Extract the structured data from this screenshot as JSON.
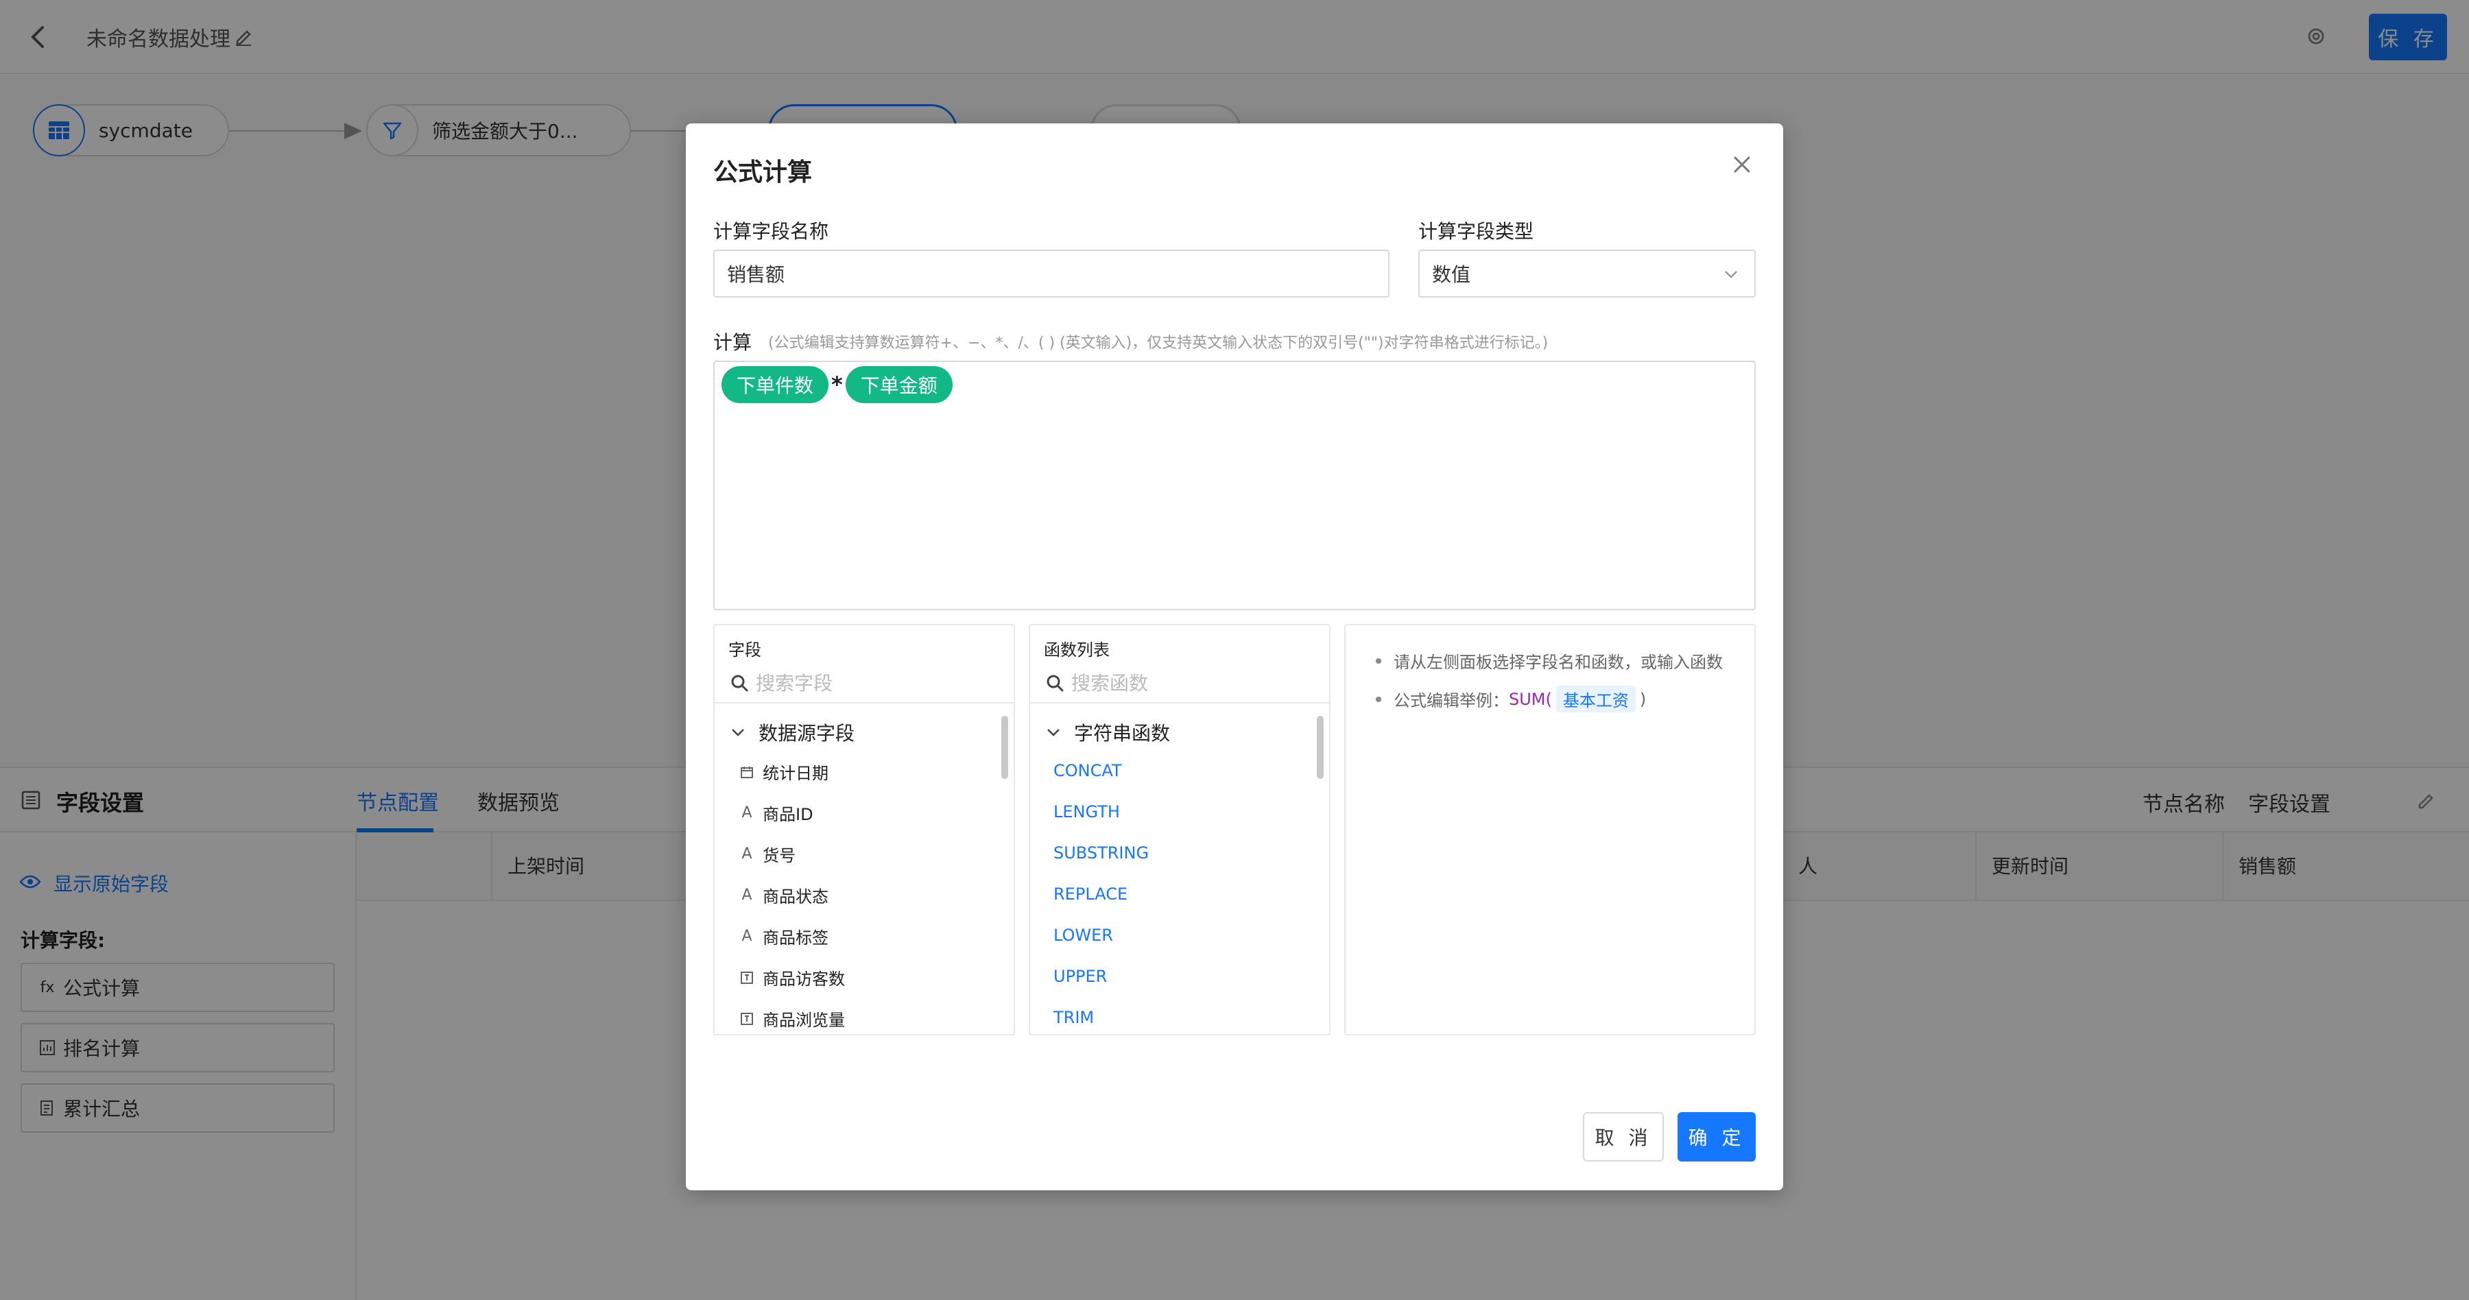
{
  "topbar": {
    "title": "未命名数据处理",
    "save_label": "保 存"
  },
  "flow": {
    "nodes": [
      {
        "label": "sycmdate"
      },
      {
        "label": "筛选金额大于0..."
      }
    ]
  },
  "bottom": {
    "title": "字段设置",
    "tabs": [
      {
        "label": "节点配置",
        "active": true
      },
      {
        "label": "数据预览",
        "active": false
      }
    ],
    "right_tabs": [
      "节点名称",
      "字段设置"
    ],
    "show_original": "显示原始字段",
    "calc_fields_label": "计算字段:",
    "calc_items": [
      {
        "icon": "fx",
        "label": "公式计算"
      },
      {
        "icon": "rank-icon",
        "label": "排名计算"
      },
      {
        "icon": "sum-icon",
        "label": "累计汇总"
      }
    ],
    "columns": [
      "",
      "上架时间",
      "人",
      "更新时间",
      "销售额"
    ]
  },
  "modal": {
    "title": "公式计算",
    "name_label": "计算字段名称",
    "name_value": "销售额",
    "type_label": "计算字段类型",
    "type_value": "数值",
    "calc_label": "计算",
    "calc_hint": "(公式编辑支持算数运算符+、−、*、/、( ) (英文输入)，仅支持英文输入状态下的双引号(\"\")对字符串格式进行标记。)",
    "formula": {
      "left_field": "下单件数",
      "operator": "*",
      "right_field": "下单金额"
    },
    "fields_panel": {
      "title": "字段",
      "search_placeholder": "搜索字段",
      "group": "数据源字段",
      "items": [
        {
          "icon": "calendar-icon",
          "label": "统计日期"
        },
        {
          "icon": "text-type-icon",
          "label": "商品ID"
        },
        {
          "icon": "text-type-icon",
          "label": "货号"
        },
        {
          "icon": "text-type-icon",
          "label": "商品状态"
        },
        {
          "icon": "text-type-icon",
          "label": "商品标签"
        },
        {
          "icon": "number-type-icon",
          "label": "商品访客数"
        },
        {
          "icon": "number-type-icon",
          "label": "商品浏览量"
        }
      ]
    },
    "functions_panel": {
      "title": "函数列表",
      "search_placeholder": "搜索函数",
      "group": "字符串函数",
      "items": [
        "CONCAT",
        "LENGTH",
        "SUBSTRING",
        "REPLACE",
        "LOWER",
        "UPPER",
        "TRIM"
      ]
    },
    "help": {
      "line1": "请从左侧面板选择字段名和函数，或输入函数",
      "line2_prefix": "公式编辑举例：",
      "line2_fn": "SUM(",
      "line2_chip": "基本工资",
      "line2_suffix": ")"
    },
    "cancel_label": "取 消",
    "ok_label": "确 定"
  }
}
